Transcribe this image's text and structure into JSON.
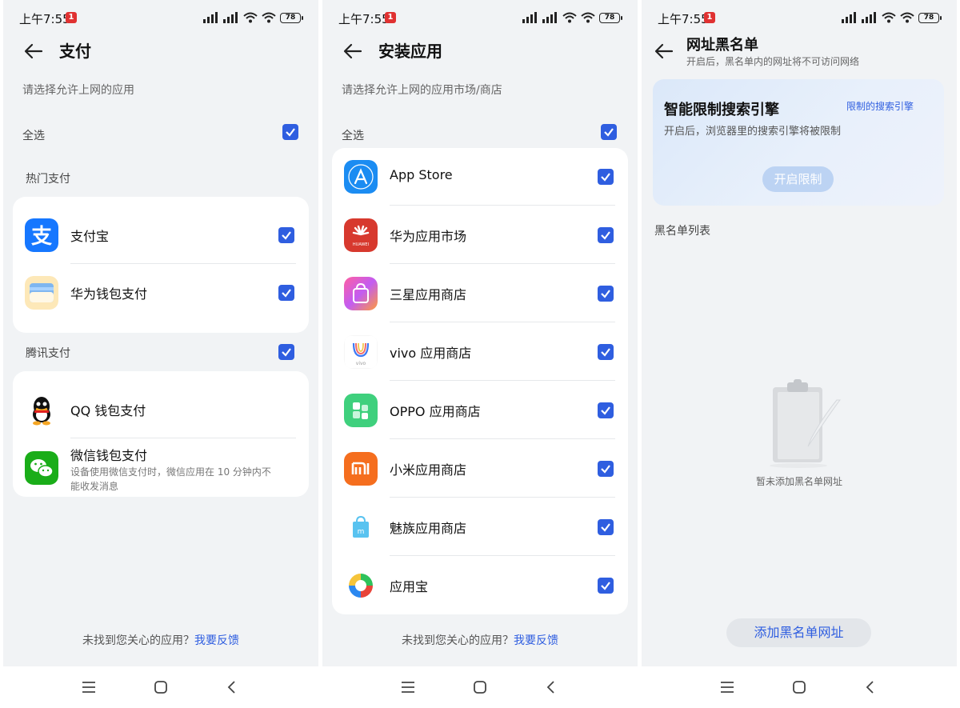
{
  "status_bar": {
    "time": "上午7:55",
    "notification_badge": "1",
    "battery": "78"
  },
  "screen1": {
    "title": "支付",
    "hint": "请选择允许上网的应用",
    "select_all": "全选",
    "groups": [
      {
        "label": "热门支付",
        "items": [
          {
            "name": "支付宝",
            "icon": "alipay-icon",
            "checked": true
          },
          {
            "name": "华为钱包支付",
            "icon": "huawei-wallet-icon",
            "checked": true
          }
        ]
      },
      {
        "label": "腾讯支付",
        "items": [
          {
            "name": "QQ 钱包支付",
            "icon": "qq-icon",
            "checked": false
          },
          {
            "name": "微信钱包支付",
            "icon": "wechat-icon",
            "checked": false,
            "desc": "设备使用微信支付时，微信应用在 10 分钟内不能收发消息"
          }
        ]
      }
    ],
    "footer_text": "未找到您关心的应用？",
    "footer_link": "我要反馈"
  },
  "screen2": {
    "title": "安装应用",
    "hint": "请选择允许上网的应用市场/商店",
    "select_all": "全选",
    "items": [
      {
        "name": "App Store",
        "icon": "app-store-icon"
      },
      {
        "name": "华为应用市场",
        "icon": "huawei-appgallery-icon"
      },
      {
        "name": "三星应用商店",
        "icon": "samsung-galaxy-store-icon"
      },
      {
        "name": "vivo 应用商店",
        "icon": "vivo-appstore-icon"
      },
      {
        "name": "OPPO 应用商店",
        "icon": "oppo-appstore-icon"
      },
      {
        "name": "小米应用商店",
        "icon": "xiaomi-appstore-icon"
      },
      {
        "name": "魅族应用商店",
        "icon": "meizu-appstore-icon"
      },
      {
        "name": "应用宝",
        "icon": "yingyongbao-icon"
      }
    ],
    "footer_text": "未找到您关心的应用？",
    "footer_link": "我要反馈"
  },
  "screen3": {
    "title": "网址黑名单",
    "subtitle": "开启后，黑名单内的网址将不可访问网络",
    "engine_title": "智能限制搜索引擎",
    "engine_link": "限制的搜索引擎",
    "engine_desc": "开启后，浏览器里的搜索引擎将被限制",
    "engine_button": "开启限制",
    "list_label": "黑名单列表",
    "empty_text": "暂未添加黑名单网址",
    "add_button": "添加黑名单网址"
  },
  "colors": {
    "accent": "#2f5ee0",
    "background": "#f1f3f5",
    "card": "#ffffff"
  }
}
